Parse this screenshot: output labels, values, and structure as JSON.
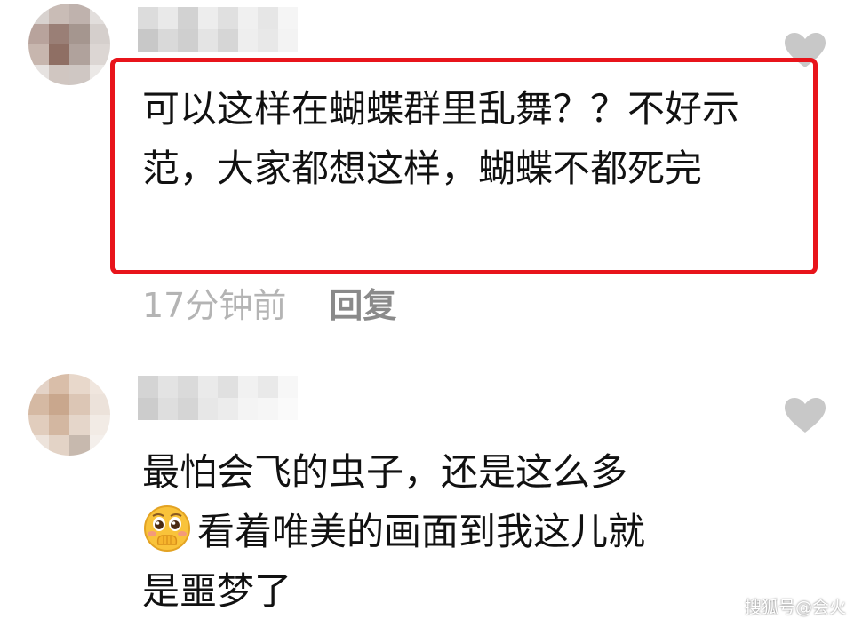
{
  "comments": [
    {
      "text": "可以这样在蝴蝶群里乱舞？？不好示范，大家都想这样，蝴蝶不都死完",
      "time": "17分钟前",
      "reply_label": "回复",
      "highlighted": true,
      "highlight_color": "#e8141b"
    },
    {
      "text_line1": "最怕会飞的虫子，还是这么多",
      "text_line2": "看着唯美的画面到我这儿就",
      "text_line3": "是噩梦了",
      "emoji": "pleading-face-hands-over-mouth-icon"
    }
  ],
  "icons": {
    "like": "heart-icon"
  },
  "colors": {
    "time_text": "#b4b4b4",
    "reply_text": "#8a8a8a",
    "like_icon": "#c8c8c8"
  },
  "watermark": "搜狐号@会火"
}
